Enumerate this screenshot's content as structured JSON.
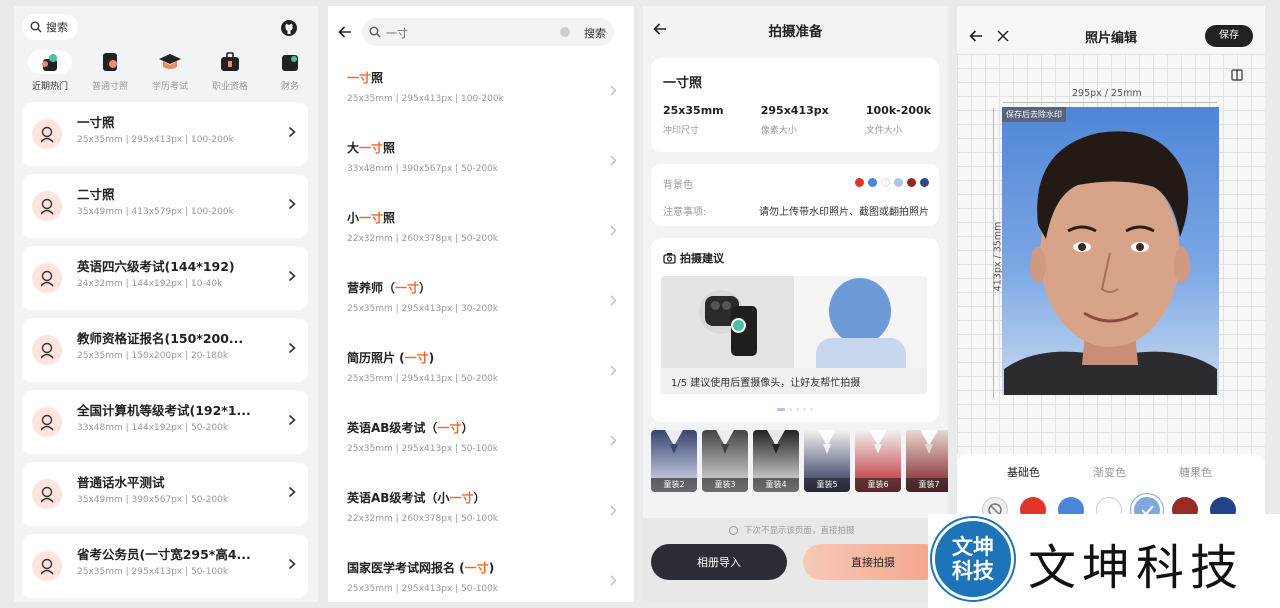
{
  "panel1": {
    "search_label": "搜索",
    "categories": [
      "近期热门",
      "普通寸照",
      "学历考试",
      "职业资格",
      "财务"
    ],
    "items": [
      {
        "title": "一寸照",
        "meta": "25x35mm | 295x413px | 100-200k"
      },
      {
        "title": "二寸照",
        "meta": "35x49mm | 413x579px | 100-200k"
      },
      {
        "title": "英语四六级考试(144*192)",
        "meta": "24x32mm | 144x192px | 10-40k"
      },
      {
        "title": "教师资格证报名(150*200...",
        "meta": "25x35mm | 150x200px | 20-180k"
      },
      {
        "title": "全国计算机等级考试(192*1...",
        "meta": "33x48mm | 144x192px | 50-200k"
      },
      {
        "title": "普通话水平测试",
        "meta": "35x49mm | 390x567px | 50-200k"
      },
      {
        "title": "省考公务员(一寸宽295*高4...",
        "meta": "25x35mm | 295x413px | 50-100k"
      }
    ]
  },
  "panel2": {
    "query": "一寸",
    "search_button": "搜索",
    "results": [
      {
        "pre": "",
        "hl": "一寸",
        "post": "照",
        "meta": "25x35mm | 295x413px | 100-200k"
      },
      {
        "pre": "大",
        "hl": "一寸",
        "post": "照",
        "meta": "33x48mm | 390x567px | 50-200k"
      },
      {
        "pre": "小",
        "hl": "一寸",
        "post": "照",
        "meta": "22x32mm | 260x378px | 50-200k"
      },
      {
        "pre": "营养师（",
        "hl": "一寸",
        "post": "）",
        "meta": "25x35mm | 295x413px | 30-200k"
      },
      {
        "pre": "简历照片 (",
        "hl": "一寸",
        "post": ")",
        "meta": "25x35mm | 295x413px | 50-200k"
      },
      {
        "pre": "英语AB级考试（",
        "hl": "一寸",
        "post": "）",
        "meta": "25x35mm | 295x413px | 50-100k"
      },
      {
        "pre": "英语AB级考试（小",
        "hl": "一寸",
        "post": "）",
        "meta": "22x32mm | 260x378px | 50-100k"
      },
      {
        "pre": "国家医学考试网报名 (",
        "hl": "一寸",
        "post": ")",
        "meta": "25x35mm | 295x413px | 50-100k"
      }
    ]
  },
  "panel3": {
    "title": "拍摄准备",
    "spec_title": "一寸照",
    "specs": [
      {
        "value": "25x35mm",
        "label": "冲印尺寸"
      },
      {
        "value": "295x413px",
        "label": "像素大小"
      },
      {
        "value": "100k-200k",
        "label": "文件大小"
      }
    ],
    "bg_label": "背景色",
    "bg_colors": [
      "#e0352b",
      "#4a86d8",
      "#ffffff",
      "#a9c6ea",
      "#8e2a22",
      "#2c4a86"
    ],
    "notice_label": "注意事项:",
    "notice_text": "请勿上传带水印照片、截图或翻拍照片",
    "advice_title": "拍摄建议",
    "advice_caption": "1/5 建议使用后置摄像头，让好友帮忙拍摄",
    "suits": [
      "童装2",
      "童装3",
      "童装4",
      "童装5",
      "童装6",
      "童装7"
    ],
    "dont_show": "下次不显示该页面，直接拍摄",
    "album_button": "相册导入",
    "shoot_button": "直接拍摄"
  },
  "panel4": {
    "title": "照片编辑",
    "save_button": "保存",
    "width_label": "295px / 25mm",
    "height_label": "413px / 35mm",
    "watermark_tag": "保存后去除水印",
    "tabs": [
      "基础色",
      "渐变色",
      "糖果色"
    ],
    "swatches": [
      "#e0352b",
      "#4a86d8",
      "#ffffff",
      "#7fa8e0",
      "#9a2a22",
      "#22428a"
    ]
  },
  "watermark": {
    "logo_text": "文坤\n科技",
    "text": "文坤科技"
  }
}
